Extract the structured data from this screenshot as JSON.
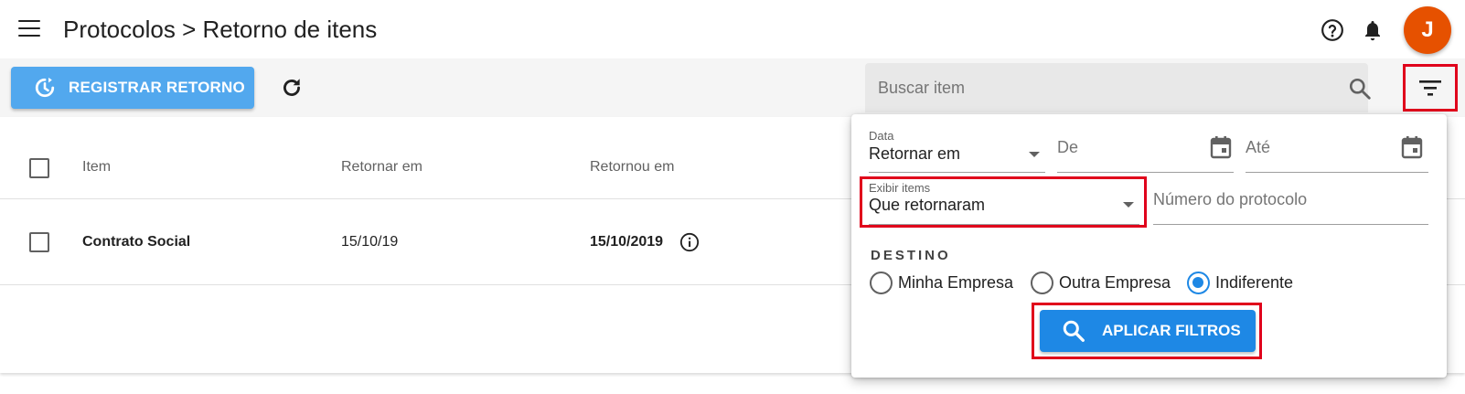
{
  "header": {
    "title": "Protocolos > Retorno de itens",
    "avatar_initial": "J",
    "avatar_color": "#e65100",
    "icons": [
      "menu-icon",
      "help-icon",
      "bell-icon"
    ]
  },
  "toolbar": {
    "register_label": "REGISTRAR RETORNO",
    "register_color": "#52a8ee",
    "search_placeholder": "Buscar item"
  },
  "table": {
    "columns": [
      "Item",
      "Retornar em",
      "Retornou em"
    ],
    "rows": [
      {
        "item": "Contrato Social",
        "retornar_em": "15/10/19",
        "retornou_em": "15/10/2019"
      }
    ]
  },
  "filters": {
    "data_label": "Data",
    "data_value": "Retornar em",
    "de_placeholder": "De",
    "ate_placeholder": "Até",
    "exibir_label": "Exibir items",
    "exibir_value": "Que retornaram",
    "protocolo_placeholder": "Número do protocolo",
    "destino_title": "DESTINO",
    "destino_options": [
      "Minha Empresa",
      "Outra Empresa",
      "Indiferente"
    ],
    "destino_selected": "Indiferente",
    "apply_label": "APLICAR FILTROS",
    "apply_color": "#1e88e5",
    "highlight_color": "#e0001b"
  }
}
